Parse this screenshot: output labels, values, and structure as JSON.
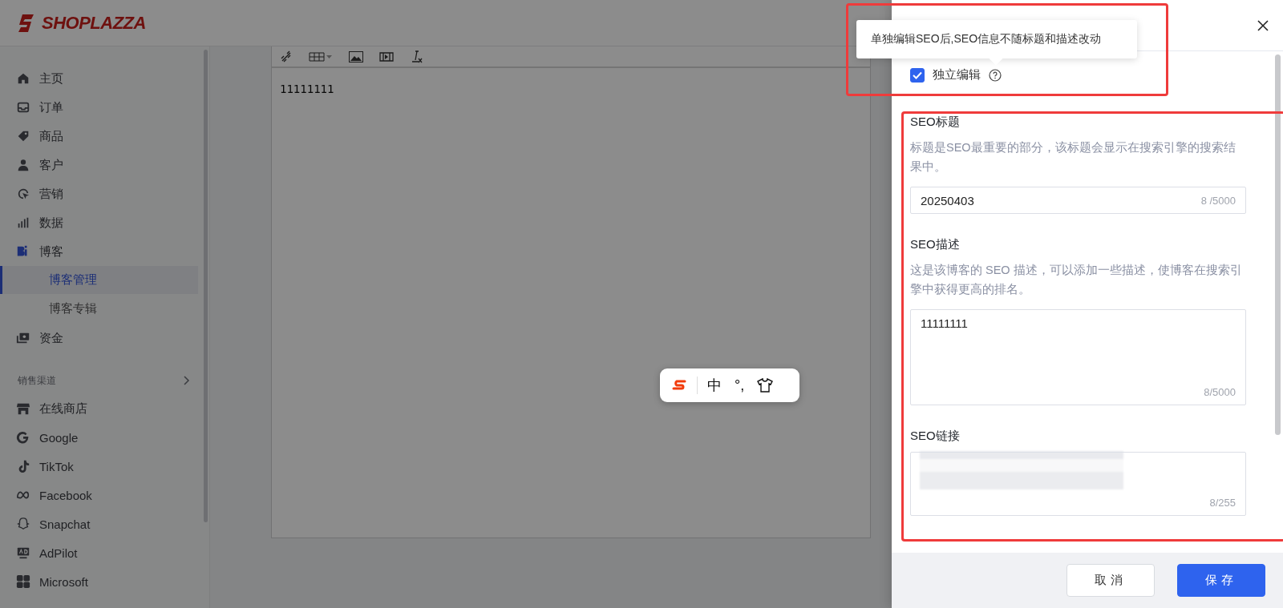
{
  "brand": {
    "name": "SHOPLAZZA"
  },
  "sidebar": {
    "items": [
      {
        "label": "主页",
        "active": false
      },
      {
        "label": "订单",
        "active": false
      },
      {
        "label": "商品",
        "active": false
      },
      {
        "label": "客户",
        "active": false
      },
      {
        "label": "营销",
        "active": false
      },
      {
        "label": "数据",
        "active": false
      },
      {
        "label": "博客",
        "active": true,
        "children": [
          {
            "label": "博客管理",
            "selected": true
          },
          {
            "label": "博客专辑",
            "selected": false
          }
        ]
      },
      {
        "label": "资金",
        "active": false
      }
    ],
    "section": {
      "title": "销售渠道"
    },
    "channels": [
      {
        "label": "在线商店"
      },
      {
        "label": "Google"
      },
      {
        "label": "TikTok"
      },
      {
        "label": "Facebook"
      },
      {
        "label": "Snapchat"
      },
      {
        "label": "AdPilot"
      },
      {
        "label": "Microsoft"
      }
    ]
  },
  "editor": {
    "content": "11111111"
  },
  "ime_bar": {
    "items": [
      {
        "kind": "logo"
      },
      {
        "kind": "text",
        "text": "中"
      },
      {
        "kind": "text",
        "text": "°,"
      },
      {
        "kind": "shirt"
      }
    ]
  },
  "drawer": {
    "tooltip": "单独编辑SEO后,SEO信息不随标题和描述改动",
    "independent_edit": {
      "label": "独立编辑",
      "checked": true
    },
    "fields": [
      {
        "kind": "input",
        "label": "SEO标题",
        "help": "标题是SEO最重要的部分，该标题会显示在搜索引擎的搜索结果中。",
        "value": "20250403",
        "counter": "8 /5000"
      },
      {
        "kind": "textarea",
        "label": "SEO描述",
        "help": "这是该博客的 SEO 描述，可以添加一些描述，使博客在搜索引擎中获得更高的排名。",
        "value": "11111111",
        "counter": "8/5000"
      },
      {
        "kind": "redacted",
        "label": "SEO链接",
        "counter": "8/255"
      }
    ],
    "buttons": [
      {
        "label": "取消",
        "kind": "secondary"
      },
      {
        "label": "保存",
        "kind": "primary"
      }
    ]
  }
}
